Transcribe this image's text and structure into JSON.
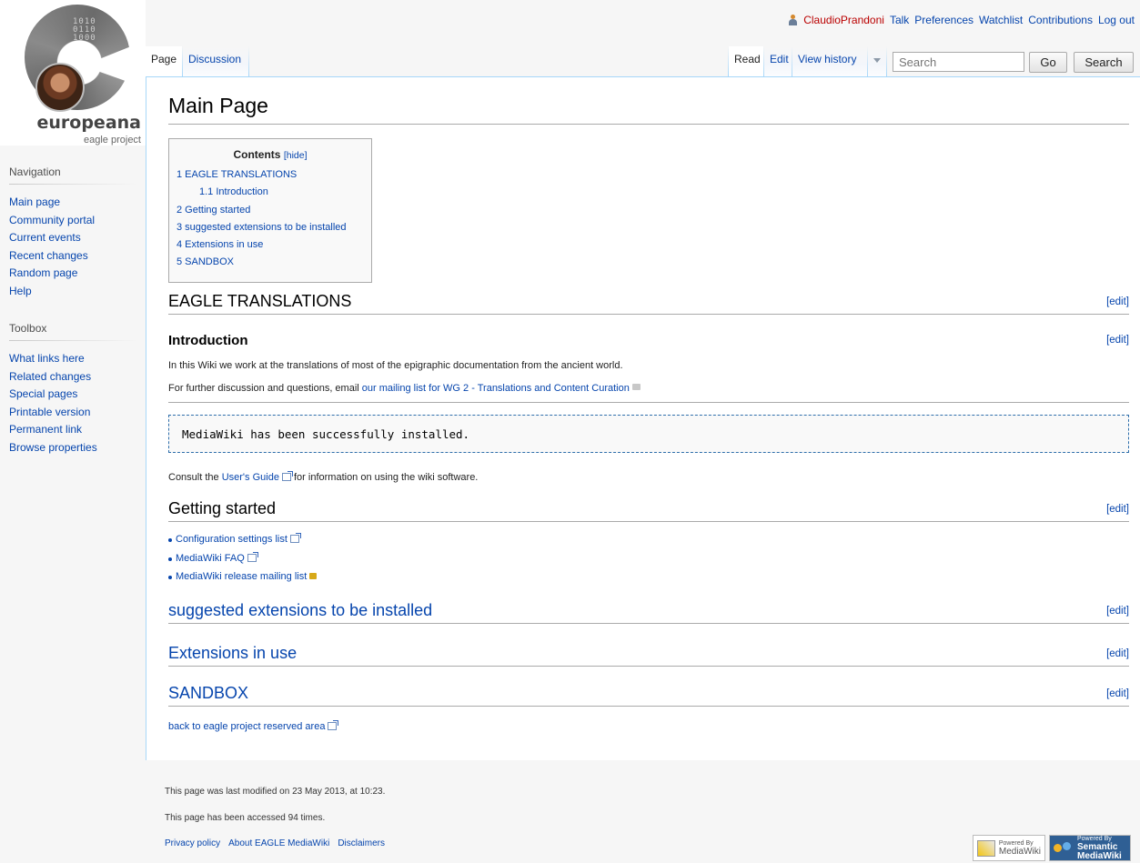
{
  "logo": {
    "wordmark": "europeana",
    "subtitle": "eagle project",
    "bits": "1010\n0110\n1000"
  },
  "personal": {
    "username": "ClaudioPrandoni",
    "talk": "Talk",
    "preferences": "Preferences",
    "watchlist": "Watchlist",
    "contributions": "Contributions",
    "logout": "Log out"
  },
  "tabs": {
    "page": "Page",
    "discussion": "Discussion",
    "read": "Read",
    "edit": "Edit",
    "history": "View history"
  },
  "search": {
    "placeholder": "Search",
    "go": "Go",
    "search_btn": "Search"
  },
  "nav": {
    "heading": "Navigation",
    "items": [
      "Main page",
      "Community portal",
      "Current events",
      "Recent changes",
      "Random page",
      "Help"
    ]
  },
  "toolbox": {
    "heading": "Toolbox",
    "items": [
      "What links here",
      "Related changes",
      "Special pages",
      "Printable version",
      "Permanent link",
      "Browse properties"
    ]
  },
  "page": {
    "title": "Main Page",
    "toc": {
      "title": "Contents",
      "hide": "[hide]",
      "entries": [
        "1 EAGLE TRANSLATIONS",
        "1.1 Introduction",
        "2 Getting started",
        "3 suggested extensions to be installed",
        "4 Extensions in use",
        "5 SANDBOX"
      ]
    },
    "edit_label": "[edit]",
    "sections": {
      "s1": "EAGLE TRANSLATIONS",
      "intro": "Introduction",
      "getting_started": "Getting started",
      "suggested": "suggested extensions to be installed",
      "extensions": "Extensions in use",
      "sandbox": "SANDBOX"
    },
    "intro_text": "In this Wiki we work at the translations of most of the epigraphic documentation from the ancient world.",
    "discussion_prefix": "For further discussion and questions, email ",
    "discussion_link": "our mailing list for WG 2 - Translations and Content Curation",
    "pre_text": "MediaWiki has been successfully installed.",
    "consult_prefix": "Consult the ",
    "consult_link": "User's Guide",
    "consult_suffix": " for information on using the wiki software.",
    "getting_started_links": [
      "Configuration settings list",
      "MediaWiki FAQ",
      "MediaWiki release mailing list"
    ],
    "back_link": "back to eagle project reserved area"
  },
  "footer": {
    "modified": "This page was last modified on 23 May 2013, at 10:23.",
    "accessed": "This page has been accessed 94 times.",
    "links": [
      "Privacy policy",
      "About EAGLE MediaWiki",
      "Disclaimers"
    ],
    "badge1_small": "Powered By",
    "badge1_big": "MediaWiki",
    "badge2_small": "Powered By",
    "badge2_big1": "Semantic",
    "badge2_big2": "MediaWiki"
  }
}
